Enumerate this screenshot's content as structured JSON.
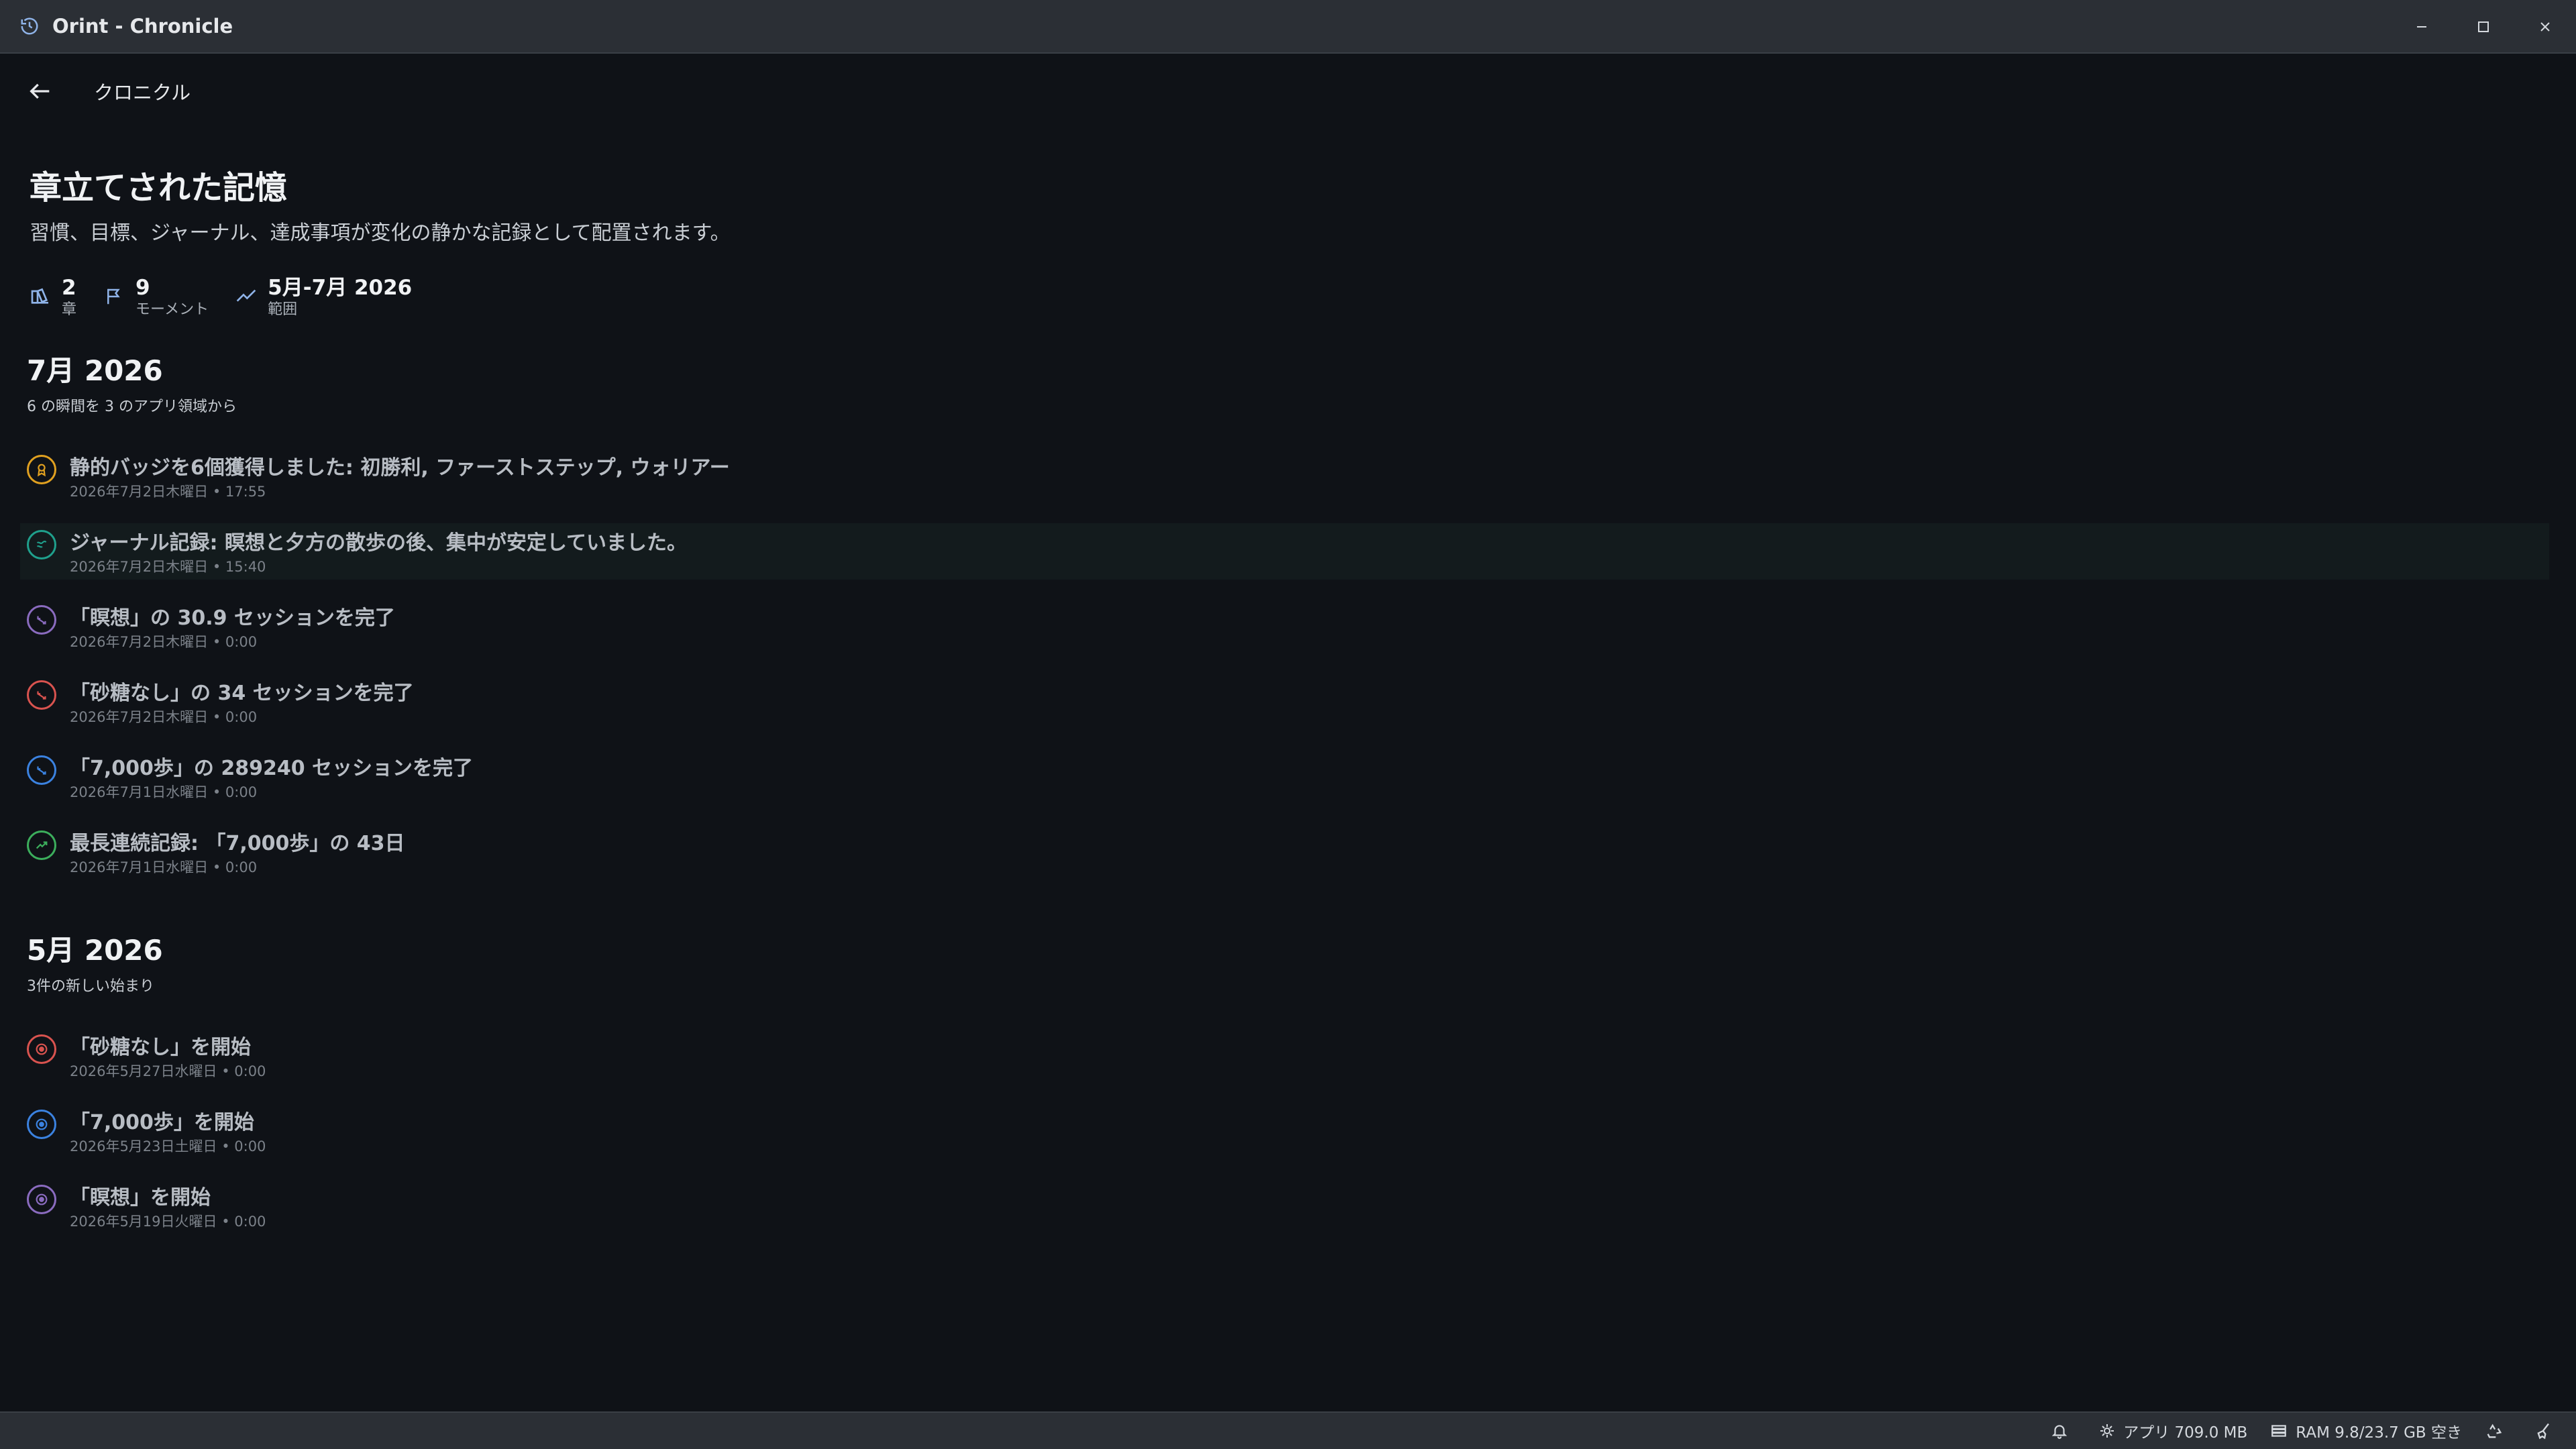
{
  "window": {
    "title": "Orint - Chronicle"
  },
  "header": {
    "title": "クロニクル"
  },
  "page": {
    "title": "章立てされた記憶",
    "subtitle": "習慣、目標、ジャーナル、達成事項が変化の静かな記録として配置されます。"
  },
  "stats": [
    {
      "value": "2",
      "label": "章",
      "icon": "chapters-icon"
    },
    {
      "value": "9",
      "label": "モーメント",
      "icon": "flag-icon"
    },
    {
      "value": "5月-7月 2026",
      "label": "範囲",
      "icon": "trend-icon"
    }
  ],
  "sections": [
    {
      "title": "7月 2026",
      "subtitle": "6 の瞬間を 3 のアプリ領域から",
      "events": [
        {
          "title": "静的バッジを6個獲得しました: 初勝利, ファーストステップ, ウォリアー",
          "date": "2026年7月2日木曜日 • 17:55",
          "color": "#e0a020",
          "icon": "badge-icon"
        },
        {
          "title": "ジャーナル記録: 瞑想と夕方の散歩の後、集中が安定していました。",
          "date": "2026年7月2日木曜日 • 15:40",
          "color": "#1fa08c",
          "icon": "journal-icon"
        },
        {
          "title": "「瞑想」の 30.9 セッションを完了",
          "date": "2026年7月2日木曜日 • 0:00",
          "color": "#8a6bbf",
          "icon": "session-icon"
        },
        {
          "title": "「砂糖なし」の 34 セッションを完了",
          "date": "2026年7月2日木曜日 • 0:00",
          "color": "#d9534f",
          "icon": "session-icon"
        },
        {
          "title": "「7,000歩」の 289240 セッションを完了",
          "date": "2026年7月1日水曜日 • 0:00",
          "color": "#3b82e0",
          "icon": "session-icon"
        },
        {
          "title": "最長連続記録: 「7,000歩」の 43日",
          "date": "2026年7月1日水曜日 • 0:00",
          "color": "#3cae5c",
          "icon": "streak-icon"
        }
      ]
    },
    {
      "title": "5月 2026",
      "subtitle": "3件の新しい始まり",
      "events": [
        {
          "title": "「砂糖なし」を開始",
          "date": "2026年5月27日水曜日 • 0:00",
          "color": "#d9534f",
          "icon": "start-icon"
        },
        {
          "title": "「7,000歩」を開始",
          "date": "2026年5月23日土曜日 • 0:00",
          "color": "#3b82e0",
          "icon": "start-icon"
        },
        {
          "title": "「瞑想」を開始",
          "date": "2026年5月19日火曜日 • 0:00",
          "color": "#8a6bbf",
          "icon": "start-icon"
        }
      ]
    }
  ],
  "statusbar": {
    "app_memory": "アプリ 709.0 MB",
    "ram": "RAM 9.8/23.7 GB 空き"
  }
}
